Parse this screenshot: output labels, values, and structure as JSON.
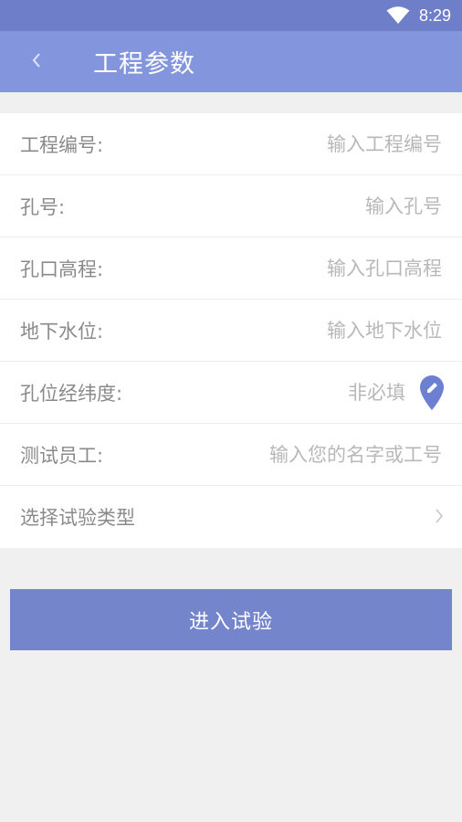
{
  "status_bar": {
    "time": "8:29",
    "wifi_icon": "wifi-icon"
  },
  "header": {
    "title": "工程参数",
    "back_icon": "chevron-left-icon"
  },
  "form": {
    "project_no": {
      "label": "工程编号:",
      "placeholder": "输入工程编号",
      "value": ""
    },
    "hole_no": {
      "label": "孔号:",
      "placeholder": "输入孔号",
      "value": ""
    },
    "hole_elevation": {
      "label": "孔口高程:",
      "placeholder": "输入孔口高程",
      "value": ""
    },
    "groundwater": {
      "label": "地下水位:",
      "placeholder": "输入地下水位",
      "value": ""
    },
    "coordinates": {
      "label": "孔位经纬度:",
      "placeholder": "非必填",
      "value": "",
      "icon": "location-pin-icon"
    },
    "tester": {
      "label": "测试员工:",
      "placeholder": "输入您的名字或工号",
      "value": ""
    },
    "test_type": {
      "label": "选择试验类型",
      "icon": "chevron-right-icon"
    }
  },
  "actions": {
    "enter_label": "进入试验"
  },
  "colors": {
    "status_bar": "#6f7ec8",
    "app_bar": "#8395dc",
    "button": "#7585cc",
    "pin": "#6d7fd1",
    "background": "#f0f0f0"
  }
}
